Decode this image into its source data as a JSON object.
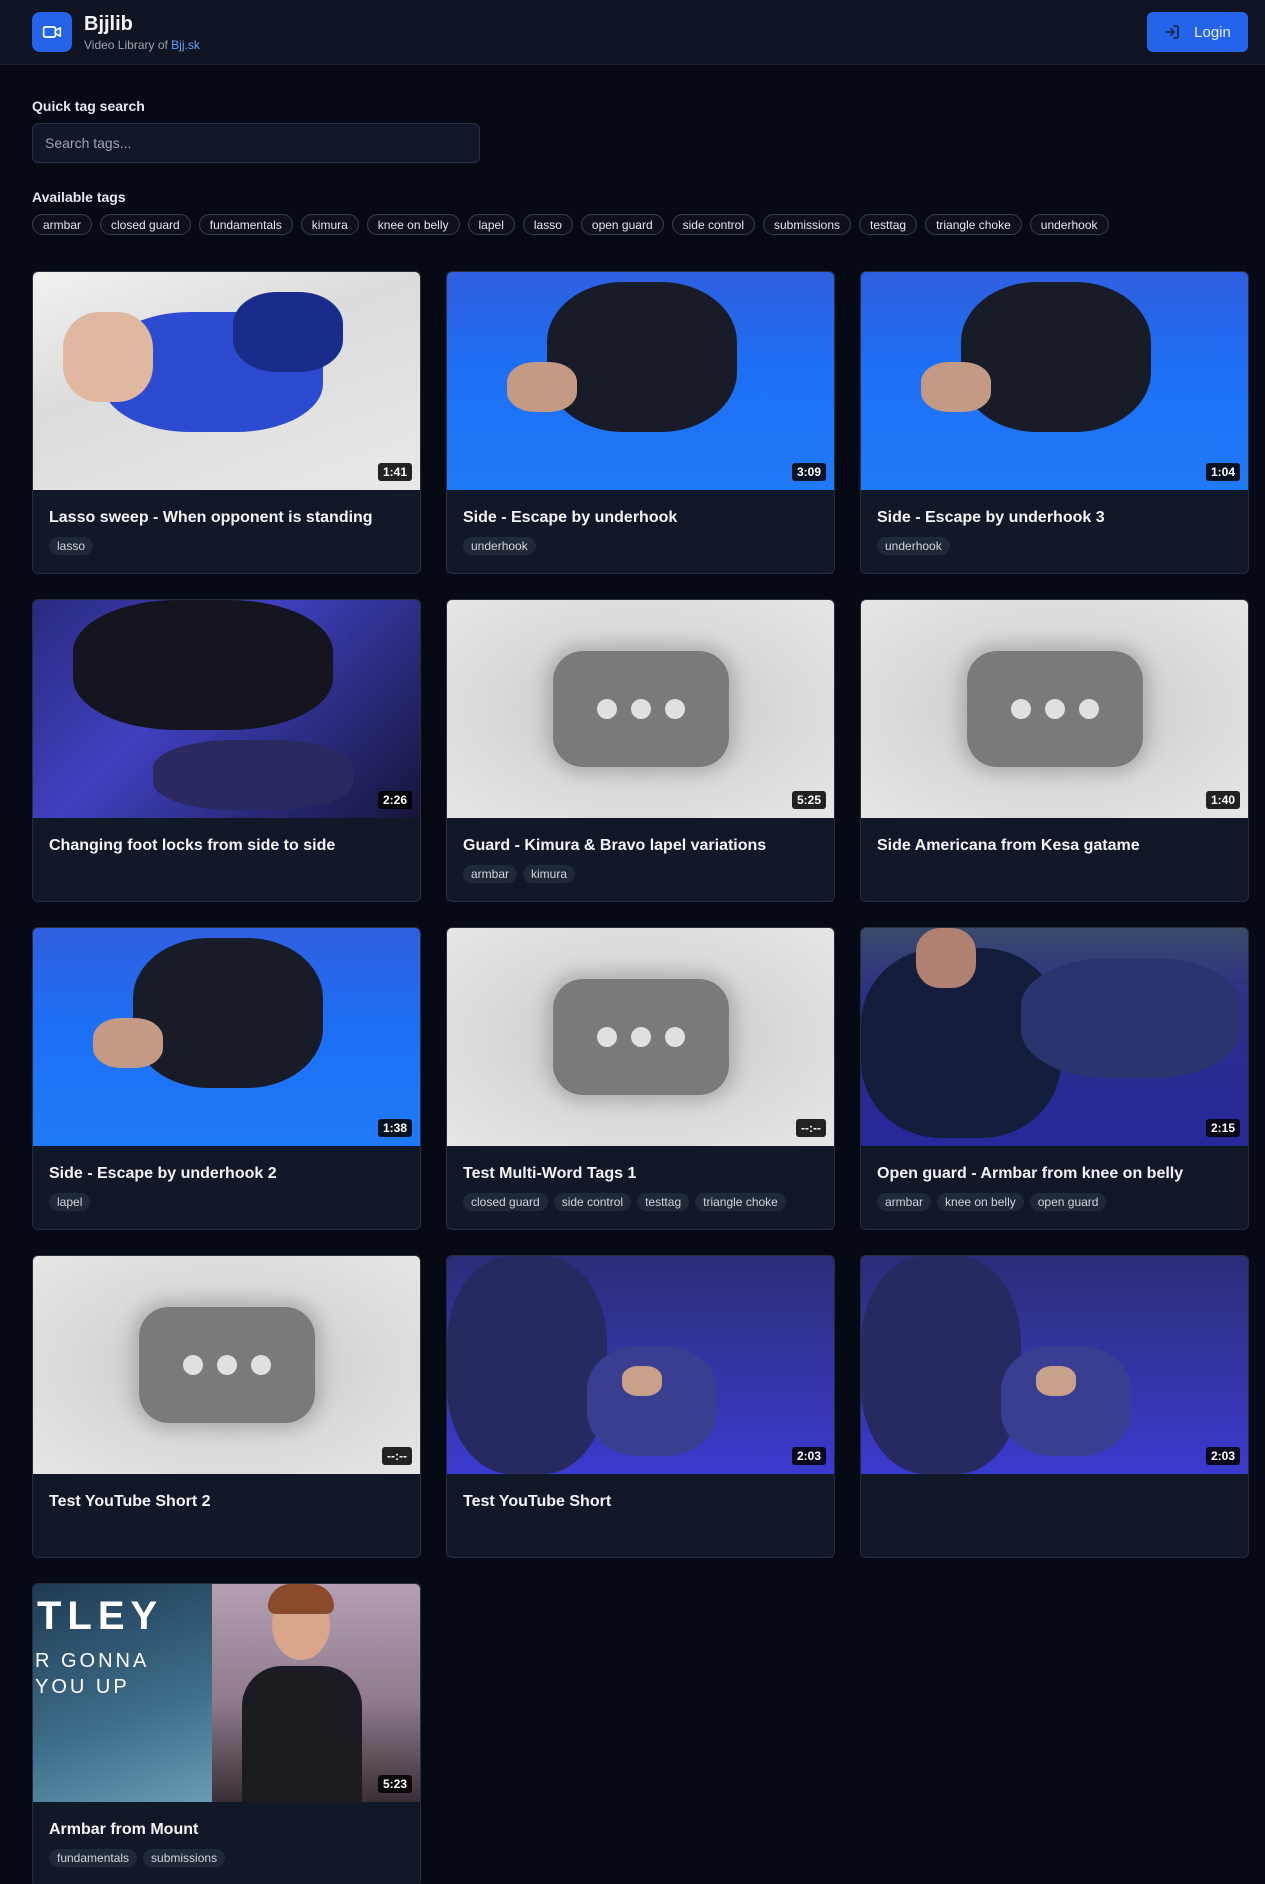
{
  "header": {
    "app_name": "Bjjlib",
    "subtitle_prefix": "Video Library of ",
    "subtitle_link": "Bjj.sk",
    "login_label": "Login"
  },
  "search": {
    "label": "Quick tag search",
    "placeholder": "Search tags..."
  },
  "available_tags": {
    "label": "Available tags",
    "items": [
      "armbar",
      "closed guard",
      "fundamentals",
      "kimura",
      "knee on belly",
      "lapel",
      "lasso",
      "open guard",
      "side control",
      "submissions",
      "testtag",
      "triangle choke",
      "underhook"
    ]
  },
  "videos": [
    {
      "title": "Lasso sweep - When opponent is standing",
      "duration": "1:41",
      "tags": [
        "lasso"
      ],
      "thumb": "photo-lasso"
    },
    {
      "title": "Side - Escape by underhook",
      "duration": "3:09",
      "tags": [
        "underhook"
      ],
      "thumb": "photo-mat"
    },
    {
      "title": "Side - Escape by underhook 3",
      "duration": "1:04",
      "tags": [
        "underhook"
      ],
      "thumb": "photo-mat"
    },
    {
      "title": "Changing foot locks from side to side",
      "duration": "2:26",
      "tags": [],
      "thumb": "photo-dark"
    },
    {
      "title": "Guard - Kimura & Bravo lapel variations",
      "duration": "5:25",
      "tags": [
        "armbar",
        "kimura"
      ],
      "thumb": "placeholder"
    },
    {
      "title": "Side Americana from Kesa gatame",
      "duration": "1:40",
      "tags": [],
      "thumb": "placeholder"
    },
    {
      "title": "Side - Escape by underhook 2",
      "duration": "1:38",
      "tags": [
        "lapel"
      ],
      "thumb": "photo-mat"
    },
    {
      "title": "Test Multi-Word Tags 1",
      "duration": "--:--",
      "tags": [
        "closed guard",
        "side control",
        "testtag",
        "triangle choke"
      ],
      "thumb": "placeholder"
    },
    {
      "title": "Open guard - Armbar from knee on belly",
      "duration": "2:15",
      "tags": [
        "armbar",
        "knee on belly",
        "open guard"
      ],
      "thumb": "photo-opengd"
    },
    {
      "title": "Test YouTube Short 2",
      "duration": "--:--",
      "tags": [],
      "thumb": "placeholder"
    },
    {
      "title": "Test YouTube Short",
      "duration": "2:03",
      "tags": [],
      "thumb": "photo-short"
    },
    {
      "title": "",
      "duration": "2:03",
      "tags": [],
      "thumb": "photo-short"
    },
    {
      "title": "Armbar from Mount",
      "duration": "5:23",
      "tags": [
        "fundamentals",
        "submissions"
      ],
      "thumb": "photo-rick",
      "thumb_text": [
        "TLEY",
        "R GONNA",
        "YOU UP"
      ]
    }
  ]
}
